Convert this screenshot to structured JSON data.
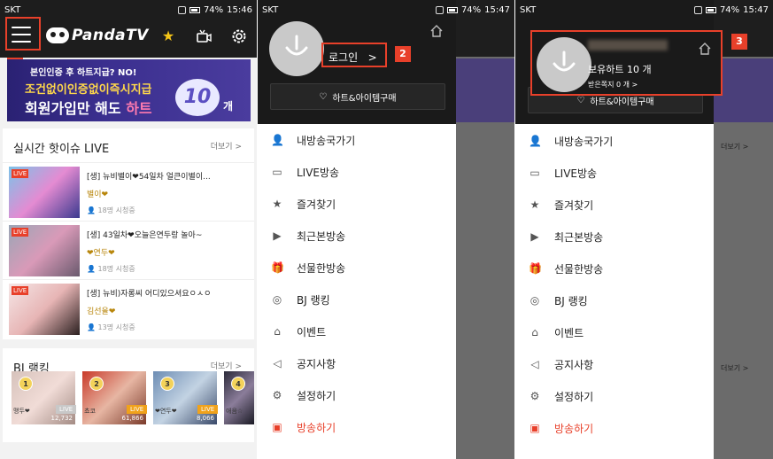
{
  "statusbar": {
    "p1": {
      "carrier": "SKT",
      "battery": "74%",
      "time": "15:46"
    },
    "p2": {
      "carrier": "SKT",
      "battery": "74%",
      "time": "15:47"
    },
    "p3": {
      "carrier": "SKT",
      "battery": "74%",
      "time": "15:47"
    }
  },
  "header": {
    "logo_text": "PandaTV"
  },
  "annotations": {
    "n1": "1",
    "n2": "2",
    "n3": "3",
    "color": "#e8402a"
  },
  "banner": {
    "line1": "본인인증 후 하트지급? NO!",
    "line2": "조건없이인증없이즉시지급",
    "line3_a": "회원가입만 해도 ",
    "line3_b": "하트",
    "amount": "10",
    "unit": "개"
  },
  "live_section": {
    "title": "실시간 핫이슈 LIVE",
    "more": "더보기 >",
    "badge": "LIVE",
    "items": [
      {
        "title": "[생] 뉴비별이❤54일차 얼큰이별이...",
        "user": "별이❤",
        "views": "18명 시청중"
      },
      {
        "title": "[생] 43일차❤오늘은연두랑 놀아~",
        "user": "❤연두❤",
        "views": "18명 시청중"
      },
      {
        "title": "[생] 뉴비)자롱씨 어디있으셔요ㅇㅅㅇ",
        "user": "김선율❤",
        "views": "13명 시청중"
      }
    ]
  },
  "bj_section": {
    "title": "BJ 랭킹",
    "more": "더보기 >",
    "items": [
      {
        "rank": "1",
        "count": "12,732",
        "name": "맹두❤",
        "tag": "LIVE"
      },
      {
        "rank": "2",
        "count": "61,866",
        "name": "쵸코",
        "tag": "LIVE"
      },
      {
        "rank": "3",
        "count": "8,066",
        "name": "❤연두❤",
        "tag": "LIVE"
      },
      {
        "rank": "4",
        "count": "",
        "name": "애음☆",
        "tag": ""
      }
    ]
  },
  "drawer": {
    "login": "로그인",
    "login_arrow": ">",
    "buy_button": "하트&아이템구매",
    "menu": [
      {
        "label": "내방송국가기",
        "icon": "person-icon"
      },
      {
        "label": "LIVE방송",
        "icon": "live-tv-icon"
      },
      {
        "label": "즐겨찾기",
        "icon": "star-icon"
      },
      {
        "label": "최근본방송",
        "icon": "play-tv-icon"
      },
      {
        "label": "선물한방송",
        "icon": "gift-icon"
      },
      {
        "label": "BJ 랭킹",
        "icon": "medal-icon"
      },
      {
        "label": "이벤트",
        "icon": "cake-icon"
      },
      {
        "label": "공지사항",
        "icon": "megaphone-icon"
      },
      {
        "label": "설정하기",
        "icon": "gear-icon"
      },
      {
        "label": "방송하기",
        "icon": "broadcast-icon"
      }
    ]
  },
  "drawer_logged": {
    "hearts": "보유하트 10 개",
    "messages": "받은쪽지 0 개 >"
  },
  "peek": {
    "more": "더보기 >",
    "rank4": "4",
    "name": "애음☆"
  }
}
